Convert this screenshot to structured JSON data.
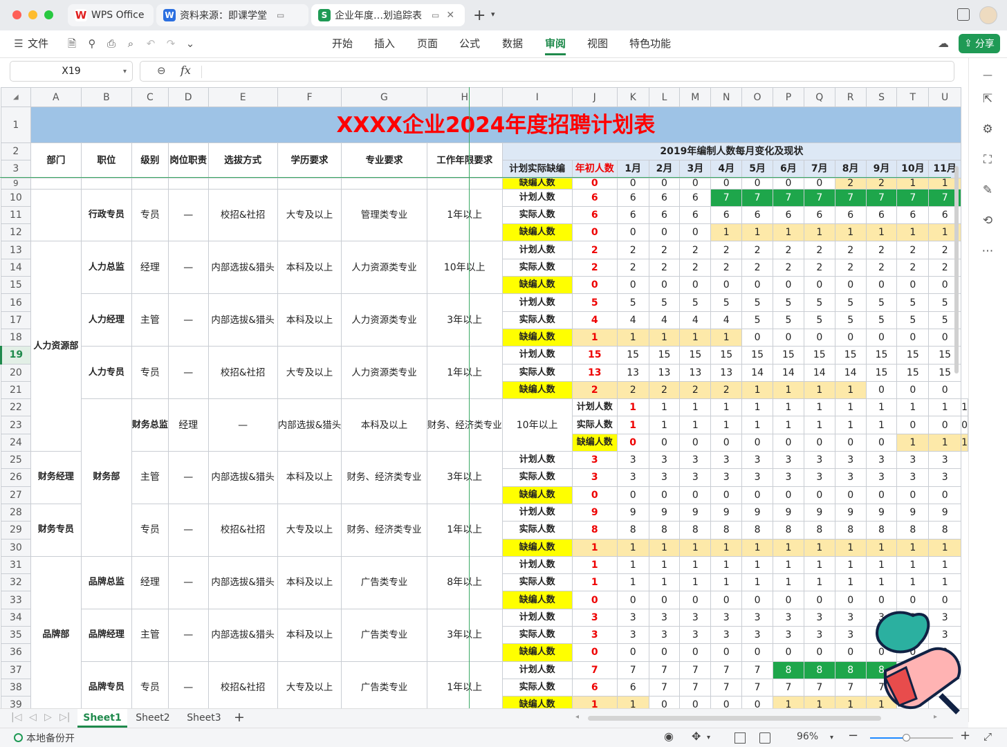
{
  "tabs": {
    "wps": "WPS Office",
    "doc": "资料来源：即课学堂",
    "sheet": "企业年度…划追踪表"
  },
  "menu": {
    "file": "文件",
    "start": "开始",
    "insert": "插入",
    "page": "页面",
    "formula": "公式",
    "data": "数据",
    "review": "审阅",
    "view": "视图",
    "special": "特色功能",
    "share": "分享"
  },
  "formula_bar": {
    "cell_ref": "X19",
    "fx": "fx"
  },
  "columns": [
    "A",
    "B",
    "C",
    "D",
    "E",
    "F",
    "G",
    "H",
    "I",
    "J",
    "K",
    "L",
    "M",
    "N",
    "O",
    "P",
    "Q",
    "R",
    "S",
    "T",
    "U"
  ],
  "sheet": {
    "title": "XXXX企业2024年度招聘计划表",
    "headers": {
      "dept": "部门",
      "pos": "职位",
      "level": "级别",
      "duty": "岗位职责",
      "method": "选拔方式",
      "edu": "学历要求",
      "major": "专业要求",
      "years": "工作年限要求",
      "plan": "计划实际缺编",
      "initial": "年初人数",
      "subtitle": "2019年编制人数每月变化及现状"
    },
    "months": [
      "1月",
      "2月",
      "3月",
      "4月",
      "5月",
      "6月",
      "7月",
      "8月",
      "9月",
      "10月",
      "11月"
    ],
    "type_labels": {
      "plan": "计划人数",
      "actual": "实际人数",
      "gap": "缺编人数"
    },
    "groups": [
      {
        "row": 10,
        "dept": "",
        "pos": "行政专员",
        "level": "专员",
        "duty": "—",
        "method": "校招&社招",
        "edu": "大专及以上",
        "major": "管理类专业",
        "years": "1年以上",
        "plan": {
          "init": "6",
          "m": [
            "6",
            "6",
            "6",
            "7",
            "7",
            "7",
            "7",
            "7",
            "7",
            "7",
            "7"
          ],
          "hl": [
            0,
            0,
            0,
            2,
            2,
            2,
            2,
            2,
            2,
            2,
            2
          ]
        },
        "actual": {
          "init": "6",
          "m": [
            "6",
            "6",
            "6",
            "6",
            "6",
            "6",
            "6",
            "6",
            "6",
            "6",
            "6"
          ],
          "hl": [
            0,
            0,
            0,
            0,
            0,
            0,
            0,
            0,
            0,
            0,
            0
          ]
        },
        "gap": {
          "init": "0",
          "m": [
            "0",
            "0",
            "0",
            "1",
            "1",
            "1",
            "1",
            "1",
            "1",
            "1",
            "1"
          ],
          "hl": [
            0,
            0,
            0,
            1,
            1,
            1,
            1,
            1,
            1,
            1,
            1
          ],
          "ihl": 0
        }
      },
      {
        "row": 13,
        "dept": "人力资源部",
        "pos": "人力总监",
        "level": "经理",
        "duty": "—",
        "method": "内部选拔&猎头",
        "edu": "本科及以上",
        "major": "人力资源类专业",
        "years": "10年以上",
        "plan": {
          "init": "2",
          "m": [
            "2",
            "2",
            "2",
            "2",
            "2",
            "2",
            "2",
            "2",
            "2",
            "2",
            "2"
          ],
          "hl": [
            0,
            0,
            0,
            0,
            0,
            0,
            0,
            0,
            0,
            0,
            0
          ]
        },
        "actual": {
          "init": "2",
          "m": [
            "2",
            "2",
            "2",
            "2",
            "2",
            "2",
            "2",
            "2",
            "2",
            "2",
            "2"
          ],
          "hl": [
            0,
            0,
            0,
            0,
            0,
            0,
            0,
            0,
            0,
            0,
            0
          ]
        },
        "gap": {
          "init": "0",
          "m": [
            "0",
            "0",
            "0",
            "0",
            "0",
            "0",
            "0",
            "0",
            "0",
            "0",
            "0"
          ],
          "hl": [
            0,
            0,
            0,
            0,
            0,
            0,
            0,
            0,
            0,
            0,
            0
          ],
          "ihl": 0
        }
      },
      {
        "row": 16,
        "dept": "",
        "pos": "人力经理",
        "level": "主管",
        "duty": "—",
        "method": "内部选拔&猎头",
        "edu": "本科及以上",
        "major": "人力资源类专业",
        "years": "3年以上",
        "plan": {
          "init": "5",
          "m": [
            "5",
            "5",
            "5",
            "5",
            "5",
            "5",
            "5",
            "5",
            "5",
            "5",
            "5"
          ],
          "hl": [
            0,
            0,
            0,
            0,
            0,
            0,
            0,
            0,
            0,
            0,
            0
          ]
        },
        "actual": {
          "init": "4",
          "m": [
            "4",
            "4",
            "4",
            "4",
            "5",
            "5",
            "5",
            "5",
            "5",
            "5",
            "5"
          ],
          "hl": [
            0,
            0,
            0,
            0,
            0,
            0,
            0,
            0,
            0,
            0,
            0
          ]
        },
        "gap": {
          "init": "1",
          "m": [
            "1",
            "1",
            "1",
            "1",
            "0",
            "0",
            "0",
            "0",
            "0",
            "0",
            "0"
          ],
          "hl": [
            1,
            1,
            1,
            1,
            0,
            0,
            0,
            0,
            0,
            0,
            0
          ],
          "ihl": 1
        }
      },
      {
        "row": 19,
        "dept": "",
        "pos": "人力专员",
        "level": "专员",
        "duty": "—",
        "method": "校招&社招",
        "edu": "大专及以上",
        "major": "人力资源类专业",
        "years": "1年以上",
        "plan": {
          "init": "15",
          "m": [
            "15",
            "15",
            "15",
            "15",
            "15",
            "15",
            "15",
            "15",
            "15",
            "15",
            "15"
          ],
          "hl": [
            0,
            0,
            0,
            0,
            0,
            0,
            0,
            0,
            0,
            0,
            0
          ]
        },
        "actual": {
          "init": "13",
          "m": [
            "13",
            "13",
            "13",
            "13",
            "14",
            "14",
            "14",
            "14",
            "15",
            "15",
            "15"
          ],
          "hl": [
            0,
            0,
            0,
            0,
            0,
            0,
            0,
            0,
            0,
            0,
            0
          ]
        },
        "gap": {
          "init": "2",
          "m": [
            "2",
            "2",
            "2",
            "2",
            "1",
            "1",
            "1",
            "1",
            "0",
            "0",
            "0"
          ],
          "hl": [
            1,
            1,
            1,
            1,
            1,
            1,
            1,
            1,
            0,
            0,
            0
          ],
          "ihl": 1
        }
      },
      {
        "row": 22,
        "dept": "",
        "pos": "财务总监",
        "level": "经理",
        "duty": "—",
        "method": "内部选拔&猎头",
        "edu": "本科及以上",
        "major": "财务、经济类专业",
        "years": "10年以上",
        "plan": {
          "init": "1",
          "m": [
            "1",
            "1",
            "1",
            "1",
            "1",
            "1",
            "1",
            "1",
            "1",
            "1",
            "1"
          ],
          "hl": [
            0,
            0,
            0,
            0,
            0,
            0,
            0,
            0,
            0,
            0,
            0
          ]
        },
        "actual": {
          "init": "1",
          "m": [
            "1",
            "1",
            "1",
            "1",
            "1",
            "1",
            "1",
            "1",
            "0",
            "0",
            "0"
          ],
          "hl": [
            0,
            0,
            0,
            0,
            0,
            0,
            0,
            0,
            0,
            0,
            0
          ]
        },
        "gap": {
          "init": "0",
          "m": [
            "0",
            "0",
            "0",
            "0",
            "0",
            "0",
            "0",
            "0",
            "1",
            "1",
            "1"
          ],
          "hl": [
            0,
            0,
            0,
            0,
            0,
            0,
            0,
            0,
            1,
            1,
            1
          ],
          "ihl": 0
        }
      },
      {
        "row": 25,
        "dept": "财务部",
        "pos": "财务经理",
        "level": "主管",
        "duty": "—",
        "method": "内部选拔&猎头",
        "edu": "本科及以上",
        "major": "财务、经济类专业",
        "years": "3年以上",
        "plan": {
          "init": "3",
          "m": [
            "3",
            "3",
            "3",
            "3",
            "3",
            "3",
            "3",
            "3",
            "3",
            "3",
            "3"
          ],
          "hl": [
            0,
            0,
            0,
            0,
            0,
            0,
            0,
            0,
            0,
            0,
            0
          ]
        },
        "actual": {
          "init": "3",
          "m": [
            "3",
            "3",
            "3",
            "3",
            "3",
            "3",
            "3",
            "3",
            "3",
            "3",
            "3"
          ],
          "hl": [
            0,
            0,
            0,
            0,
            0,
            0,
            0,
            0,
            0,
            0,
            0
          ]
        },
        "gap": {
          "init": "0",
          "m": [
            "0",
            "0",
            "0",
            "0",
            "0",
            "0",
            "0",
            "0",
            "0",
            "0",
            "0"
          ],
          "hl": [
            0,
            0,
            0,
            0,
            0,
            0,
            0,
            0,
            0,
            0,
            0
          ],
          "ihl": 0
        }
      },
      {
        "row": 28,
        "dept": "",
        "pos": "财务专员",
        "level": "专员",
        "duty": "—",
        "method": "校招&社招",
        "edu": "大专及以上",
        "major": "财务、经济类专业",
        "years": "1年以上",
        "plan": {
          "init": "9",
          "m": [
            "9",
            "9",
            "9",
            "9",
            "9",
            "9",
            "9",
            "9",
            "9",
            "9",
            "9"
          ],
          "hl": [
            0,
            0,
            0,
            0,
            0,
            0,
            0,
            0,
            0,
            0,
            0
          ]
        },
        "actual": {
          "init": "8",
          "m": [
            "8",
            "8",
            "8",
            "8",
            "8",
            "8",
            "8",
            "8",
            "8",
            "8",
            "8"
          ],
          "hl": [
            0,
            0,
            0,
            0,
            0,
            0,
            0,
            0,
            0,
            0,
            0
          ]
        },
        "gap": {
          "init": "1",
          "m": [
            "1",
            "1",
            "1",
            "1",
            "1",
            "1",
            "1",
            "1",
            "1",
            "1",
            "1"
          ],
          "hl": [
            1,
            1,
            1,
            1,
            1,
            1,
            1,
            1,
            1,
            1,
            1
          ],
          "ihl": 1
        }
      },
      {
        "row": 31,
        "dept": "",
        "pos": "品牌总监",
        "level": "经理",
        "duty": "—",
        "method": "内部选拔&猎头",
        "edu": "本科及以上",
        "major": "广告类专业",
        "years": "8年以上",
        "plan": {
          "init": "1",
          "m": [
            "1",
            "1",
            "1",
            "1",
            "1",
            "1",
            "1",
            "1",
            "1",
            "1",
            "1"
          ],
          "hl": [
            0,
            0,
            0,
            0,
            0,
            0,
            0,
            0,
            0,
            0,
            0
          ]
        },
        "actual": {
          "init": "1",
          "m": [
            "1",
            "1",
            "1",
            "1",
            "1",
            "1",
            "1",
            "1",
            "1",
            "1",
            "1"
          ],
          "hl": [
            0,
            0,
            0,
            0,
            0,
            0,
            0,
            0,
            0,
            0,
            0
          ]
        },
        "gap": {
          "init": "0",
          "m": [
            "0",
            "0",
            "0",
            "0",
            "0",
            "0",
            "0",
            "0",
            "0",
            "0",
            "0"
          ],
          "hl": [
            0,
            0,
            0,
            0,
            0,
            0,
            0,
            0,
            0,
            0,
            0
          ],
          "ihl": 0
        }
      },
      {
        "row": 34,
        "dept": "品牌部",
        "pos": "品牌经理",
        "level": "主管",
        "duty": "—",
        "method": "内部选拔&猎头",
        "edu": "本科及以上",
        "major": "广告类专业",
        "years": "3年以上",
        "plan": {
          "init": "3",
          "m": [
            "3",
            "3",
            "3",
            "3",
            "3",
            "3",
            "3",
            "3",
            "3",
            "3",
            "3"
          ],
          "hl": [
            0,
            0,
            0,
            0,
            0,
            0,
            0,
            0,
            0,
            0,
            0
          ]
        },
        "actual": {
          "init": "3",
          "m": [
            "3",
            "3",
            "3",
            "3",
            "3",
            "3",
            "3",
            "3",
            "3",
            "3",
            "3"
          ],
          "hl": [
            0,
            0,
            0,
            0,
            0,
            0,
            0,
            0,
            0,
            0,
            0
          ]
        },
        "gap": {
          "init": "0",
          "m": [
            "0",
            "0",
            "0",
            "0",
            "0",
            "0",
            "0",
            "0",
            "0",
            "0",
            "0"
          ],
          "hl": [
            0,
            0,
            0,
            0,
            0,
            0,
            0,
            0,
            0,
            0,
            0
          ],
          "ihl": 0
        }
      },
      {
        "row": 37,
        "dept": "",
        "pos": "品牌专员",
        "level": "专员",
        "duty": "—",
        "method": "校招&社招",
        "edu": "大专及以上",
        "major": "广告类专业",
        "years": "1年以上",
        "plan": {
          "init": "7",
          "m": [
            "7",
            "7",
            "7",
            "7",
            "7",
            "8",
            "8",
            "8",
            "8",
            "",
            ""
          ],
          "hl": [
            0,
            0,
            0,
            0,
            0,
            2,
            2,
            2,
            2,
            0,
            0
          ]
        },
        "actual": {
          "init": "6",
          "m": [
            "6",
            "7",
            "7",
            "7",
            "7",
            "7",
            "7",
            "7",
            "7",
            "",
            ""
          ],
          "hl": [
            0,
            0,
            0,
            0,
            0,
            0,
            0,
            0,
            0,
            0,
            0
          ]
        },
        "gap": {
          "init": "1",
          "m": [
            "1",
            "0",
            "0",
            "0",
            "0",
            "1",
            "1",
            "1",
            "1",
            "",
            ""
          ],
          "hl": [
            1,
            0,
            0,
            0,
            0,
            1,
            1,
            1,
            1,
            0,
            0
          ],
          "ihl": 1
        }
      }
    ],
    "row9": {
      "label": "缺编人数",
      "init": "0",
      "m": [
        "0",
        "0",
        "0",
        "0",
        "0",
        "0",
        "0",
        "2",
        "2",
        "1",
        "1"
      ],
      "hl": [
        0,
        0,
        0,
        0,
        0,
        0,
        0,
        1,
        1,
        1,
        1
      ]
    }
  },
  "sheet_tabs": [
    "Sheet1",
    "Sheet2",
    "Sheet3"
  ],
  "status": {
    "backup": "本地备份开",
    "zoom": "96%"
  },
  "colors": {
    "title_bg": "#9ec3e6",
    "title_fg": "#ff0000",
    "yellow_label": "#ffff00",
    "light_yellow": "#fde9a9",
    "green": "#1ea64b",
    "accent": "#1f8a4c"
  }
}
